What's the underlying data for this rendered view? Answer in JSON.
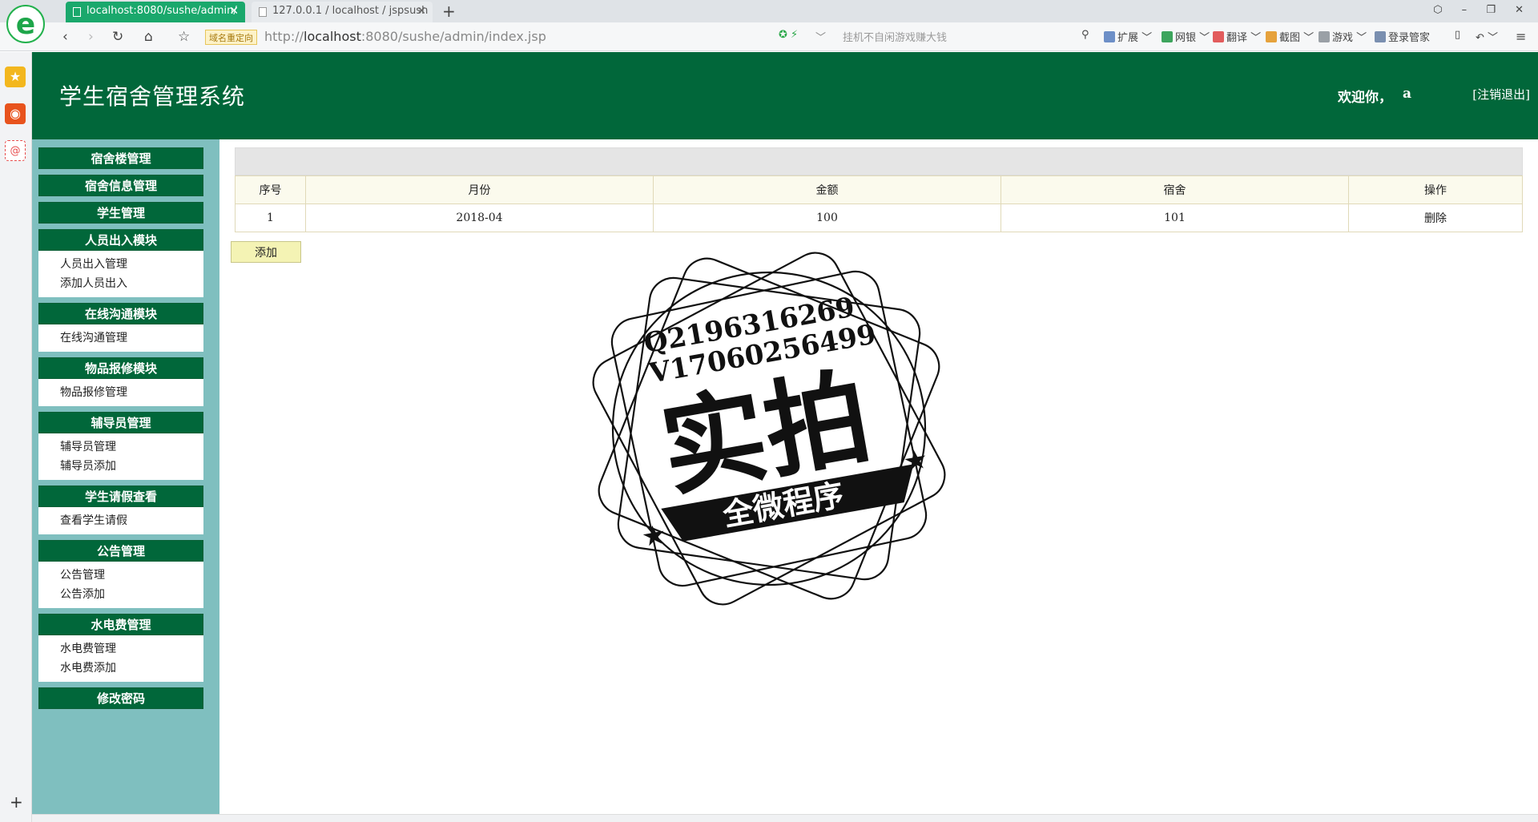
{
  "browser": {
    "tabs": [
      {
        "title": "localhost:8080/sushe/admin/"
      },
      {
        "title": "127.0.0.1 / localhost / jspsush"
      }
    ],
    "redirect_badge": "域名重定向",
    "url_prefix": "http://",
    "url_host": "localhost",
    "url_rest": ":8080/sushe/admin/index.jsp",
    "search_placeholder": "挂机不自闲游戏赚大钱",
    "toolbar": [
      "扩展",
      "网银",
      "翻译",
      "截图",
      "游戏",
      "登录管家"
    ]
  },
  "header": {
    "title": "学生宿舍管理系统",
    "welcome": "欢迎你，",
    "username": "a",
    "logout": "[注销退出]"
  },
  "sidebar": {
    "menus": [
      {
        "label": "宿舍楼管理",
        "items": []
      },
      {
        "label": "宿舍信息管理",
        "items": []
      },
      {
        "label": "学生管理",
        "items": []
      },
      {
        "label": "人员出入模块",
        "items": [
          "人员出入管理",
          "添加人员出入"
        ]
      },
      {
        "label": "在线沟通模块",
        "items": [
          "在线沟通管理"
        ]
      },
      {
        "label": "物品报修模块",
        "items": [
          "物品报修管理"
        ]
      },
      {
        "label": "辅导员管理",
        "items": [
          "辅导员管理",
          "辅导员添加"
        ]
      },
      {
        "label": "学生请假查看",
        "items": [
          "查看学生请假"
        ]
      },
      {
        "label": "公告管理",
        "items": [
          "公告管理",
          "公告添加"
        ]
      },
      {
        "label": "水电费管理",
        "items": [
          "水电费管理",
          "水电费添加"
        ]
      },
      {
        "label": "修改密码",
        "items": []
      }
    ]
  },
  "table": {
    "columns": [
      "序号",
      "月份",
      "金额",
      "宿舍",
      "操作"
    ],
    "rows": [
      [
        "1",
        "2018-04",
        "100",
        "101",
        "删除"
      ]
    ]
  },
  "add_button": "添加",
  "watermark": {
    "line1": "Q2196316269",
    "line2": "V17060256499",
    "big": "实拍",
    "banner": "全微程序"
  }
}
